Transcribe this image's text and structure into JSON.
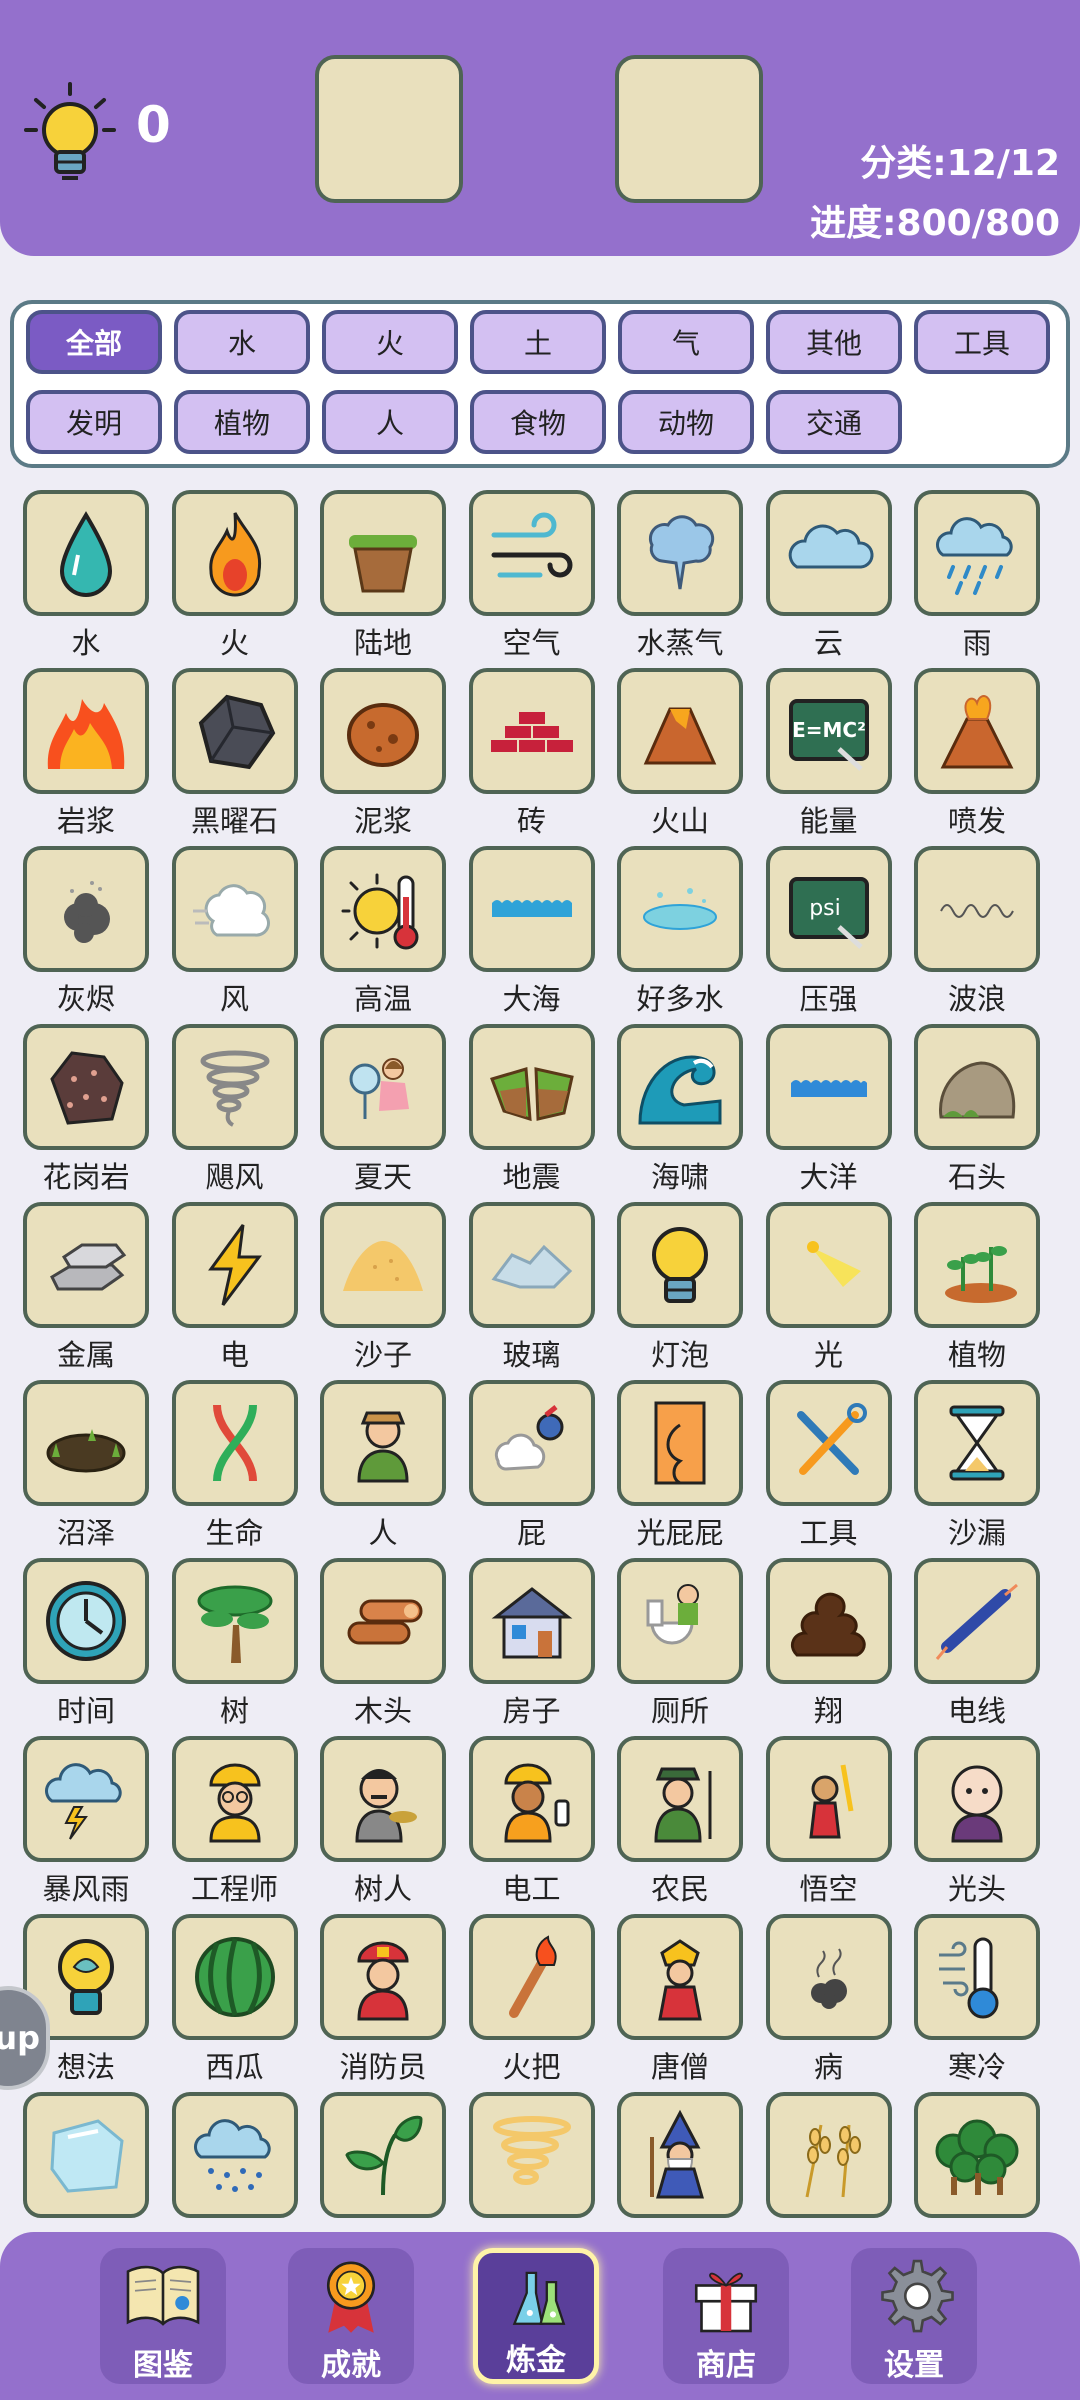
{
  "header": {
    "hint_count": "0",
    "category_stat": "分类:12/12",
    "progress_stat": "进度:800/800"
  },
  "filters": [
    "全部",
    "水",
    "火",
    "土",
    "气",
    "其他",
    "工具",
    "发明",
    "植物",
    "人",
    "食物",
    "动物",
    "交通"
  ],
  "active_filter": "全部",
  "elements": [
    {
      "label": "水",
      "icon": "water-drop-icon"
    },
    {
      "label": "火",
      "icon": "fire-icon"
    },
    {
      "label": "陆地",
      "icon": "land-icon"
    },
    {
      "label": "空气",
      "icon": "air-icon"
    },
    {
      "label": "水蒸气",
      "icon": "steam-icon"
    },
    {
      "label": "云",
      "icon": "cloud-icon"
    },
    {
      "label": "雨",
      "icon": "rain-icon"
    },
    {
      "label": "岩浆",
      "icon": "magma-icon"
    },
    {
      "label": "黑曜石",
      "icon": "obsidian-icon"
    },
    {
      "label": "泥浆",
      "icon": "mud-icon"
    },
    {
      "label": "砖",
      "icon": "brick-icon"
    },
    {
      "label": "火山",
      "icon": "volcano-icon"
    },
    {
      "label": "能量",
      "icon": "energy-board-icon"
    },
    {
      "label": "喷发",
      "icon": "eruption-icon"
    },
    {
      "label": "灰烬",
      "icon": "ash-icon"
    },
    {
      "label": "风",
      "icon": "wind-icon"
    },
    {
      "label": "高温",
      "icon": "heat-icon"
    },
    {
      "label": "大海",
      "icon": "sea-icon"
    },
    {
      "label": "好多水",
      "icon": "puddle-icon"
    },
    {
      "label": "压强",
      "icon": "pressure-board-icon"
    },
    {
      "label": "波浪",
      "icon": "wave-icon"
    },
    {
      "label": "花岗岩",
      "icon": "granite-icon"
    },
    {
      "label": "飓风",
      "icon": "hurricane-icon"
    },
    {
      "label": "夏天",
      "icon": "summer-icon"
    },
    {
      "label": "地震",
      "icon": "earthquake-icon"
    },
    {
      "label": "海啸",
      "icon": "tsunami-icon"
    },
    {
      "label": "大洋",
      "icon": "ocean-icon"
    },
    {
      "label": "石头",
      "icon": "stone-icon"
    },
    {
      "label": "金属",
      "icon": "metal-icon"
    },
    {
      "label": "电",
      "icon": "electricity-icon"
    },
    {
      "label": "沙子",
      "icon": "sand-icon"
    },
    {
      "label": "玻璃",
      "icon": "glass-icon"
    },
    {
      "label": "灯泡",
      "icon": "light-bulb-icon"
    },
    {
      "label": "光",
      "icon": "light-icon"
    },
    {
      "label": "植物",
      "icon": "plant-icon"
    },
    {
      "label": "沼泽",
      "icon": "swamp-icon"
    },
    {
      "label": "生命",
      "icon": "dna-icon"
    },
    {
      "label": "人",
      "icon": "person-icon"
    },
    {
      "label": "屁",
      "icon": "fart-icon"
    },
    {
      "label": "光屁屁",
      "icon": "butt-icon"
    },
    {
      "label": "工具",
      "icon": "tools-icon"
    },
    {
      "label": "沙漏",
      "icon": "hourglass-icon"
    },
    {
      "label": "时间",
      "icon": "clock-icon"
    },
    {
      "label": "树",
      "icon": "tree-icon"
    },
    {
      "label": "木头",
      "icon": "wood-icon"
    },
    {
      "label": "房子",
      "icon": "house-icon"
    },
    {
      "label": "厕所",
      "icon": "toilet-icon"
    },
    {
      "label": "翔",
      "icon": "poop-icon"
    },
    {
      "label": "电线",
      "icon": "wire-icon"
    },
    {
      "label": "暴风雨",
      "icon": "storm-icon"
    },
    {
      "label": "工程师",
      "icon": "engineer-icon"
    },
    {
      "label": "树人",
      "icon": "treant-icon"
    },
    {
      "label": "电工",
      "icon": "electrician-icon"
    },
    {
      "label": "农民",
      "icon": "farmer-icon"
    },
    {
      "label": "悟空",
      "icon": "wukong-icon"
    },
    {
      "label": "光头",
      "icon": "bald-head-icon"
    },
    {
      "label": "想法",
      "icon": "idea-icon"
    },
    {
      "label": "西瓜",
      "icon": "watermelon-icon"
    },
    {
      "label": "消防员",
      "icon": "firefighter-icon"
    },
    {
      "label": "火把",
      "icon": "torch-icon"
    },
    {
      "label": "唐僧",
      "icon": "monk-icon"
    },
    {
      "label": "病",
      "icon": "sickness-icon"
    },
    {
      "label": "寒冷",
      "icon": "cold-icon"
    },
    {
      "label": "",
      "icon": "ice-icon"
    },
    {
      "label": "",
      "icon": "snow-cloud-icon"
    },
    {
      "label": "",
      "icon": "leaves-icon"
    },
    {
      "label": "",
      "icon": "sandstorm-icon"
    },
    {
      "label": "",
      "icon": "wizard-icon"
    },
    {
      "label": "",
      "icon": "wheat-icon"
    },
    {
      "label": "",
      "icon": "forest-icon"
    }
  ],
  "side_tab": "up",
  "nav": [
    {
      "label": "图鉴",
      "icon": "book-icon"
    },
    {
      "label": "成就",
      "icon": "medal-icon"
    },
    {
      "label": "炼金",
      "icon": "flask-icon"
    },
    {
      "label": "商店",
      "icon": "gift-icon"
    },
    {
      "label": "设置",
      "icon": "gear-icon"
    }
  ],
  "active_nav": "炼金"
}
